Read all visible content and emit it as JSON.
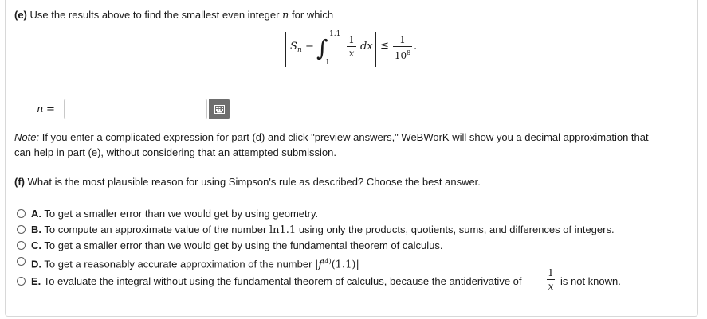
{
  "part_e": {
    "label": "(e)",
    "text": "Use the results above to find the smallest even integer",
    "var": "n",
    "after": "for which",
    "formula": {
      "S": "S",
      "S_sub": "n",
      "minus": "−",
      "int_upper": "1.1",
      "int_lower": "1",
      "integrand_num": "1",
      "integrand_den": "x",
      "dx": "dx",
      "leq": "≤",
      "rhs_num": "1",
      "rhs_den_base": "10",
      "rhs_den_exp": "8",
      "period": "."
    }
  },
  "answer": {
    "label_var": "n",
    "label_eq": "=",
    "value": "",
    "placeholder": ""
  },
  "note": {
    "line1_italic": "Note:",
    "line1": "If you enter a complicated expression for part (d) and click \"preview answers,\" WeBWorK will show you a decimal approximation that",
    "line2": "can help in part (e), without considering that an attempted submission."
  },
  "part_f": {
    "label": "(f)",
    "text": "What is the most plausible reason for using Simpson's rule as described? Choose the best answer."
  },
  "options": {
    "a": {
      "key": "A.",
      "text": "To get a smaller error than we would get by using geometry."
    },
    "b": {
      "key": "B.",
      "text_pre": "To compute an approximate value of the number",
      "ln": "ln",
      "num": "1.1",
      "text_post": "using only the products, quotients, sums, and differences of integers."
    },
    "c": {
      "key": "C.",
      "text": "To get a smaller error than we would get by using the fundamental theorem of calculus."
    },
    "d": {
      "key": "D.",
      "text_pre": "To get a reasonably accurate approximation of the number",
      "abs_l": "|",
      "f": "f",
      "sup": "(4)",
      "arg": "(1.1)",
      "abs_r": "|"
    },
    "e": {
      "key": "E.",
      "text_pre": "To evaluate the integral without using the fundamental theorem of calculus, because the antiderivative of",
      "frac_num": "1",
      "frac_den": "x",
      "text_post": "is not known."
    }
  }
}
